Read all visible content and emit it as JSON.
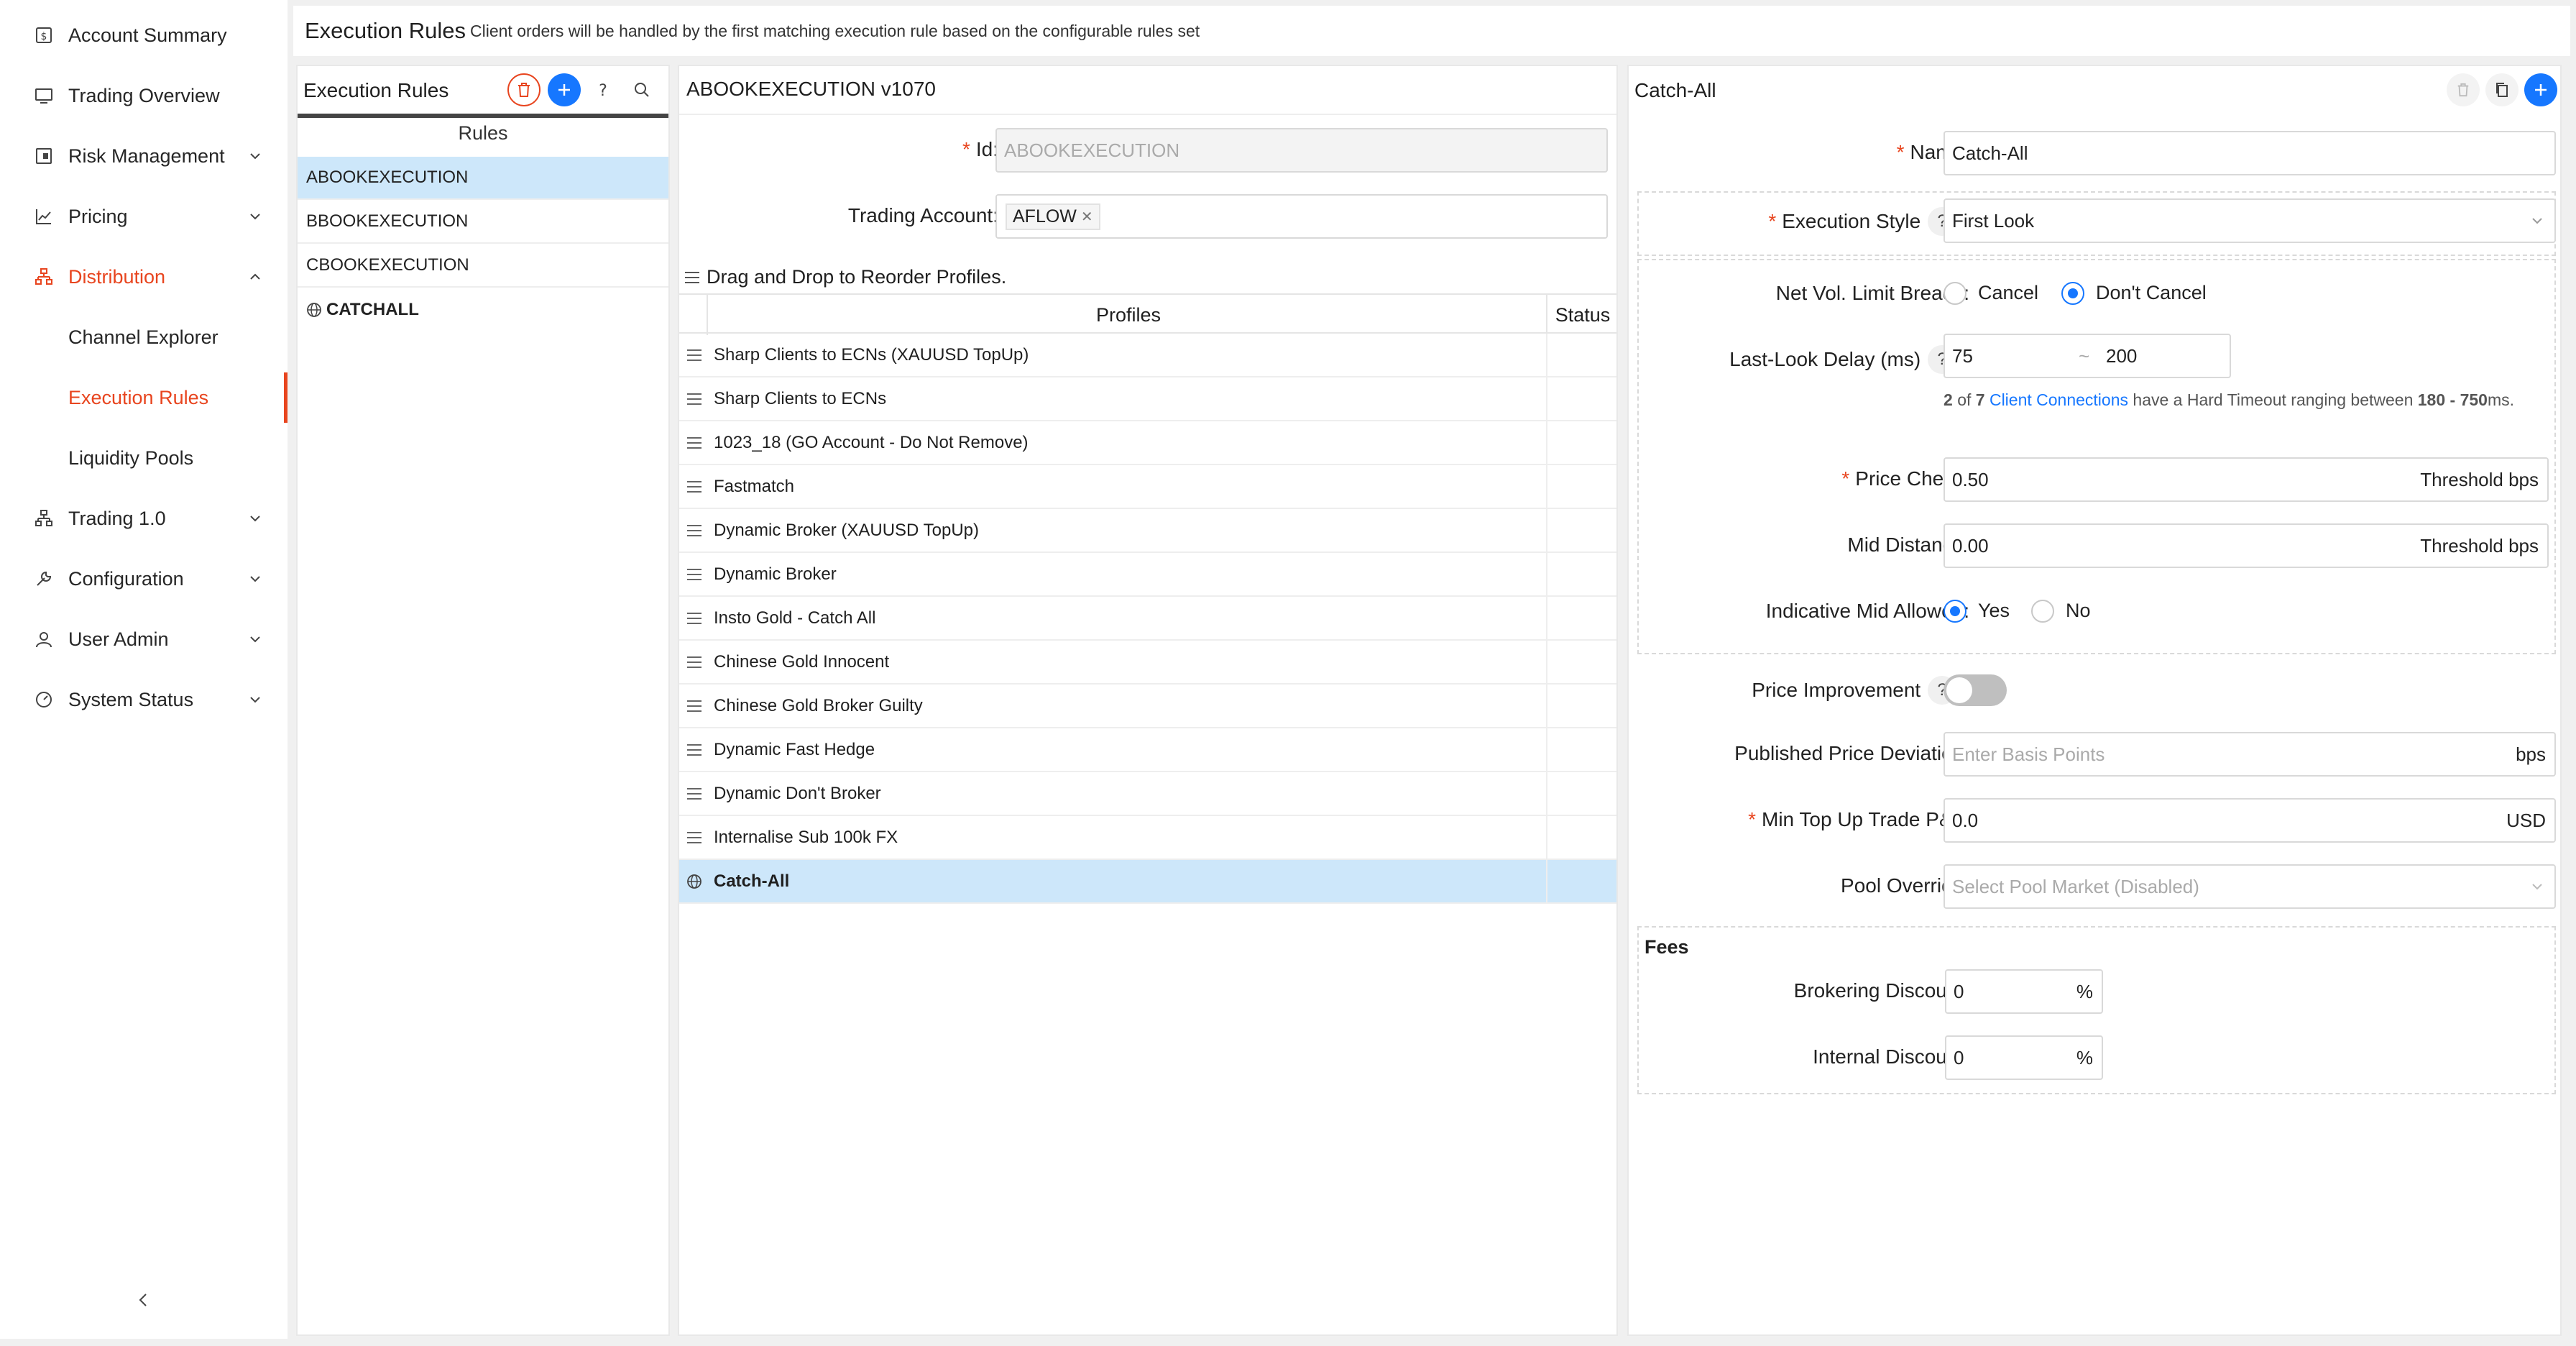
{
  "sidebar": {
    "items": [
      {
        "label": "Account Summary",
        "icon": "account-summary-icon",
        "chevron": false
      },
      {
        "label": "Trading Overview",
        "icon": "monitor-icon",
        "chevron": false
      },
      {
        "label": "Risk Management",
        "icon": "risk-icon",
        "chevron": true
      },
      {
        "label": "Pricing",
        "icon": "chart-icon",
        "chevron": true
      },
      {
        "label": "Distribution",
        "icon": "distribution-icon",
        "chevron": "up"
      },
      {
        "label": "Channel Explorer",
        "sub": true
      },
      {
        "label": "Execution Rules",
        "sub": true,
        "selected": true
      },
      {
        "label": "Liquidity Pools",
        "sub": true
      },
      {
        "label": "Trading 1.0",
        "icon": "sitemap-icon",
        "chevron": true
      },
      {
        "label": "Configuration",
        "icon": "wrench-icon",
        "chevron": true
      },
      {
        "label": "User Admin",
        "icon": "user-icon",
        "chevron": true
      },
      {
        "label": "System Status",
        "icon": "dashboard-icon",
        "chevron": true
      }
    ]
  },
  "header": {
    "title": "Execution Rules",
    "description": "Client orders will be handled by the first matching execution rule based on the configurable rules set"
  },
  "rules_panel": {
    "title": "Execution Rules",
    "list_header": "Rules",
    "rules": [
      "ABOOKEXECUTION",
      "BBOOKEXECUTION",
      "CBOOKEXECUTION",
      "CATCHALL"
    ],
    "selected_rule": "ABOOKEXECUTION"
  },
  "rule_detail": {
    "title": "ABOOKEXECUTION v1070",
    "id_label": "Id",
    "id_value": "ABOOKEXECUTION",
    "trading_account_label": "Trading Account",
    "trading_account_tag": "AFLOW",
    "dnd_hint": "Drag and Drop to Reorder Profiles.",
    "col_profiles": "Profiles",
    "col_status": "Status",
    "profiles": [
      "Sharp Clients to ECNs (XAUUSD TopUp)",
      "Sharp Clients to ECNs",
      "1023_18 (GO Account - Do Not Remove)",
      "Fastmatch",
      "Dynamic Broker (XAUUSD TopUp)",
      "Dynamic Broker",
      "Insto Gold - Catch All",
      "Chinese Gold Innocent",
      "Chinese Gold Broker Guilty",
      "Dynamic Fast Hedge",
      "Dynamic Don't Broker",
      "Internalise Sub 100k FX",
      "Catch-All"
    ],
    "selected_profile": "Catch-All"
  },
  "profile_detail": {
    "title": "Catch-All",
    "name_label": "Name",
    "name_value": "Catch-All",
    "execution_style_label": "Execution Style",
    "execution_style_value": "First Look",
    "net_vol_label": "Net Vol. Limit Breach",
    "net_vol_options": [
      "Cancel",
      "Don't Cancel"
    ],
    "net_vol_selected": "Don't Cancel",
    "last_look_label": "Last-Look Delay (ms)",
    "last_look_min": "75",
    "last_look_tilde": "~",
    "last_look_max": "200",
    "note_count": "2",
    "note_of": "of",
    "note_total": "7",
    "note_link": "Client Connections",
    "note_text": "have a Hard Timeout ranging between",
    "note_range": "180 - 750",
    "note_unit": "ms.",
    "price_check_label": "Price Check",
    "price_check_value": "0.50",
    "price_check_suffix": "Threshold bps",
    "mid_distance_label": "Mid Distance",
    "mid_distance_value": "0.00",
    "mid_distance_suffix": "Threshold bps",
    "indicative_mid_label": "Indicative Mid Allowed",
    "indicative_mid_options": [
      "Yes",
      "No"
    ],
    "indicative_mid_selected": "Yes",
    "price_improvement_label": "Price Improvement",
    "price_improvement_on": false,
    "published_dev_label": "Published Price Deviation",
    "published_dev_placeholder": "Enter Basis Points",
    "published_dev_suffix": "bps",
    "min_topup_label": "Min Top Up Trade P&L",
    "min_topup_value": "0.0",
    "min_topup_suffix": "USD",
    "pool_override_label": "Pool Override",
    "pool_override_placeholder": "Select Pool Market (Disabled)",
    "fees_title": "Fees",
    "brokering_discount_label": "Brokering Discount",
    "brokering_discount_value": "0",
    "internal_discount_label": "Internal Discount",
    "internal_discount_value": "0",
    "percent": "%"
  },
  "colors": {
    "accent": "#e8451f",
    "primary": "#1677ff",
    "selected_row": "#cde7fa"
  }
}
